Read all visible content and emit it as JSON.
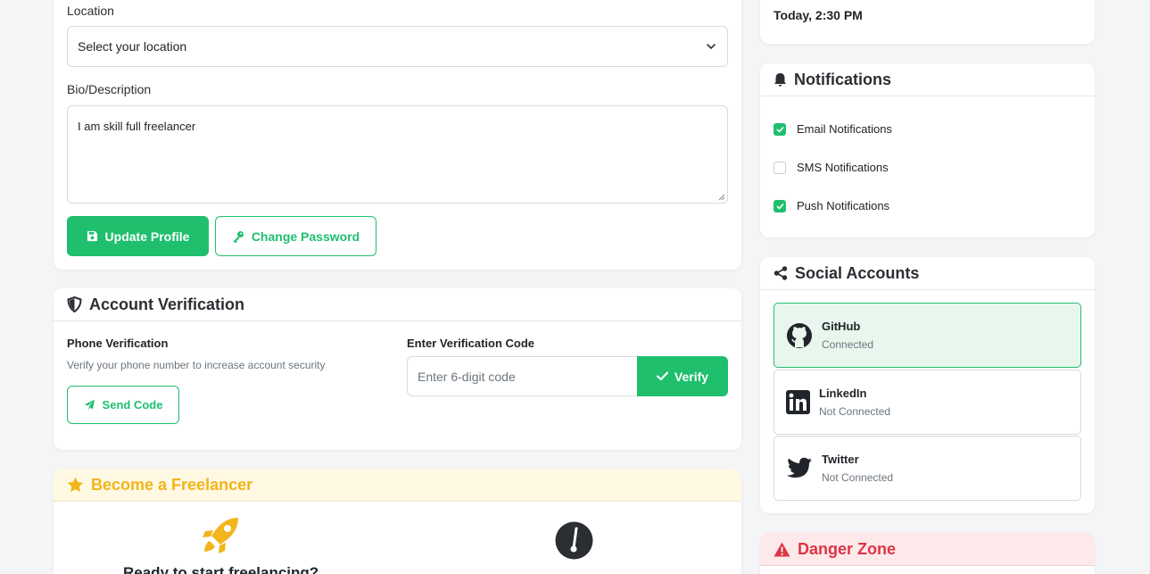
{
  "profile": {
    "location_label": "Location",
    "location_value": "Select your location",
    "bio_label": "Bio/Description",
    "bio_value": "I am skill full freelancer",
    "update_button": "Update Profile",
    "change_password_button": "Change Password"
  },
  "verification": {
    "title": "Account Verification",
    "phone_title": "Phone Verification",
    "phone_desc": "Verify your phone number to increase account security",
    "send_code_button": "Send Code",
    "code_label": "Enter Verification Code",
    "code_placeholder": "Enter 6-digit code",
    "verify_button": "Verify"
  },
  "freelancer": {
    "title": "Become a Freelancer",
    "ready_text": "Ready to start freelancing?"
  },
  "activity": {
    "time": "Today, 2:30 PM"
  },
  "notifications": {
    "title": "Notifications",
    "items": [
      {
        "label": "Email Notifications",
        "checked": true
      },
      {
        "label": "SMS Notifications",
        "checked": false
      },
      {
        "label": "Push Notifications",
        "checked": true
      }
    ]
  },
  "social": {
    "title": "Social Accounts",
    "items": [
      {
        "name": "GitHub",
        "status": "Connected",
        "icon": "github-icon"
      },
      {
        "name": "LinkedIn",
        "status": "Not Connected",
        "icon": "linkedin-icon"
      },
      {
        "name": "Twitter",
        "status": "Not Connected",
        "icon": "twitter-icon"
      }
    ]
  },
  "danger": {
    "title": "Danger Zone"
  },
  "colors": {
    "primary": "#1fbf6e",
    "warning": "#f2b51b",
    "danger": "#dc3545"
  }
}
